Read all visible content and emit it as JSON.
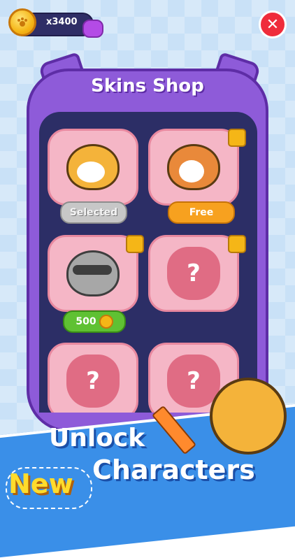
{
  "header": {
    "coin_count": "x3400",
    "coin_icon": "paw-coin-icon",
    "close_icon": "close-icon"
  },
  "shop": {
    "title": "Skins Shop",
    "items": [
      {
        "character": "shiba",
        "button_label": "Selected",
        "state": "selected"
      },
      {
        "character": "corgi",
        "button_label": "Free",
        "state": "free",
        "locked": true
      },
      {
        "character": "raccoon",
        "button_label": "500",
        "state": "price",
        "locked": true
      },
      {
        "character": "mystery-cat",
        "symbol": "?",
        "locked": true
      },
      {
        "character": "mystery-rabbit",
        "symbol": "?"
      },
      {
        "character": "mystery-dog",
        "symbol": "?"
      }
    ]
  },
  "banner": {
    "line1": "Unlock",
    "line2_highlight": "New",
    "line2": "Characters"
  },
  "colors": {
    "frame": "#8e5bd9",
    "inner": "#2c2e66",
    "tile": "#f5b6c6",
    "free": "#f7a11f",
    "price": "#5fc133",
    "close": "#ef2c3b"
  }
}
